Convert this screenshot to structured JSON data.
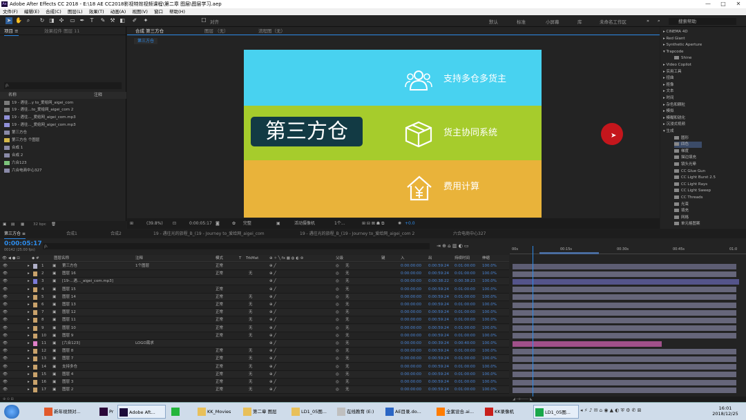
{
  "window": {
    "title": "Adobe After Effects CC 2018 - E:\\18 AE CC2018影视特效视频课程\\第二章 图层\\图层学习.aep",
    "controls": [
      "—",
      "□",
      "✕"
    ]
  },
  "menu": [
    "文件(F)",
    "编辑(E)",
    "合成(C)",
    "图层(L)",
    "效果(T)",
    "动画(A)",
    "视图(V)",
    "窗口",
    "帮助(H)"
  ],
  "toolbar": {
    "snap": "对齐",
    "workspaces": [
      "默认",
      "标准",
      "小屏幕",
      "库",
      "未命名工作区"
    ],
    "search_placeholder": "搜索帮助"
  },
  "project": {
    "tabs": [
      "项目 ≡",
      "效果控件 图层 11"
    ],
    "search_placeholder": "ρ.",
    "columns": {
      "name": "名称",
      "comment": "注释"
    },
    "items": [
      "19 - 遇往...y to_爱给网_aigei_com",
      "19 - 遇往...to_爱给网_aigei_com 2",
      "19 - 遇往..._爱给网_aigei_com.mp3",
      "19 - 遇往..._爱给网_aigei_com.mp3",
      "第三方仓",
      "第三方仓 个图层",
      "合成 1",
      "合成 2",
      "六合123",
      "六合电商中心327"
    ],
    "bpc": "32 bpc"
  },
  "viewer": {
    "tabs": [
      "合成 第三方仓",
      "图层 （无）",
      "流程图（无）"
    ],
    "comp_tab": "第三方仓",
    "canvas": {
      "title": "第三方仓",
      "rows": [
        "支持多仓多货主",
        "货主协同系统",
        "费用计算"
      ],
      "colors": {
        "cyan": "#48d2f0",
        "green": "#a6cc2c",
        "orange": "#e9b33a",
        "title_bg": "#123a44"
      }
    },
    "bottom": {
      "zoom": "(39.8%)",
      "time": "0:00:05:17",
      "quality": "完整",
      "camera": "活动摄像机",
      "views": "1个...",
      "exposure": "+0.0"
    }
  },
  "effects": {
    "items": [
      "▸ CINEMA 4D",
      "▸ Red Giant",
      "▸ Synthetic Aperture",
      "▾ Trapcode",
      "Shine",
      "▸ Video Copilot",
      "▸ 实用工具",
      "▸ 扭曲",
      "▸ 抠像",
      "▸ 文本",
      "▸ 时间",
      "▸ 杂色和颗粒",
      "▸ 模拟",
      "▸ 模糊和锐化",
      "▸ 沉浸式视频",
      "▾ 生成",
      "圆形",
      "四色",
      "梯度",
      "描边填充",
      "镜头光晕",
      "CC Glue Gun",
      "CC Light Burst 2.5",
      "CC Light Rays",
      "CC Light Sweep",
      "CC Threads",
      "光束",
      "填充",
      "网格",
      "单元格图案"
    ]
  },
  "timeline": {
    "tabs": [
      "第三方仓 ≡",
      "合成1",
      "合成2",
      "19 - 遇往光的旅程_B_(19 - Journey to_爱给网_aigei_com",
      "19 - 遇往光的旅程_B_(19 - Journey to_爱给网_aigei_com 2",
      "六合电商中心327"
    ],
    "time": "0:00:05:17",
    "frames": "00142 (25.00 fps)",
    "headers": {
      "name": "图层名称",
      "comment": "注释",
      "mode": "模式",
      "t": "T",
      "trkmat": "TrkMat",
      "parent": "父级",
      "key": "键",
      "in": "入",
      "out": "出",
      "duration": "持续时间",
      "stretch": "伸缩"
    },
    "ruler": [
      "00s",
      "00:15s",
      "00:30s",
      "00:45s",
      "01:0"
    ],
    "layers": [
      {
        "n": "1",
        "name": "第三方仓",
        "comment": "1个图层",
        "mode": "正常",
        "trk": "",
        "parent": "无",
        "in": "0:00:00:00",
        "out": "0:00:59:24",
        "dur": "0:01:00:00",
        "st": "100.0%",
        "color": "#b0b0c8",
        "bar": "#5d5d73"
      },
      {
        "n": "2",
        "name": "图层 16",
        "comment": "",
        "mode": "正常",
        "trk": "无",
        "parent": "无",
        "in": "0:00:00:00",
        "out": "0:00:59:24",
        "dur": "0:01:00:00",
        "st": "100.0%",
        "color": "#c9a26b",
        "bar": "#66667a"
      },
      {
        "n": "3",
        "name": "[19-...遇..._aigei_com.mp3]",
        "comment": "",
        "mode": "",
        "trk": "",
        "parent": "无",
        "in": "0:00:00:00",
        "out": "0:00:38:22",
        "dur": "0:00:38:23",
        "st": "100.0%",
        "color": "#7b7bd8",
        "bar": "#54548a"
      },
      {
        "n": "4",
        "name": "图层 15",
        "comment": "",
        "mode": "正常",
        "trk": "",
        "parent": "无",
        "in": "0:00:00:00",
        "out": "0:00:59:24",
        "dur": "0:01:00:00",
        "st": "100.0%",
        "color": "#c9a26b",
        "bar": "#66667a"
      },
      {
        "n": "5",
        "name": "图层 14",
        "comment": "",
        "mode": "正常",
        "trk": "无",
        "parent": "无",
        "in": "0:00:00:00",
        "out": "0:00:59:24",
        "dur": "0:01:00:00",
        "st": "100.0%",
        "color": "#c9a26b",
        "bar": "#66667a"
      },
      {
        "n": "6",
        "name": "图层 13",
        "comment": "",
        "mode": "正常",
        "trk": "无",
        "parent": "无",
        "in": "0:00:00:00",
        "out": "0:00:59:24",
        "dur": "0:01:00:00",
        "st": "100.0%",
        "color": "#c9a26b",
        "bar": "#66667a"
      },
      {
        "n": "7",
        "name": "图层 12",
        "comment": "",
        "mode": "正常",
        "trk": "无",
        "parent": "无",
        "in": "0:00:00:00",
        "out": "0:00:59:24",
        "dur": "0:01:00:00",
        "st": "100.0%",
        "color": "#c9a26b",
        "bar": "#66667a"
      },
      {
        "n": "8",
        "name": "图层 11",
        "comment": "",
        "mode": "正常",
        "trk": "无",
        "parent": "无",
        "in": "0:00:00:00",
        "out": "0:00:59:24",
        "dur": "0:01:00:00",
        "st": "100.0%",
        "color": "#c9a26b",
        "bar": "#66667a"
      },
      {
        "n": "9",
        "name": "图层 10",
        "comment": "",
        "mode": "正常",
        "trk": "无",
        "parent": "无",
        "in": "0:00:00:00",
        "out": "0:00:59:24",
        "dur": "0:01:00:00",
        "st": "100.0%",
        "color": "#c9a26b",
        "bar": "#66667a"
      },
      {
        "n": "10",
        "name": "图层 9",
        "comment": "",
        "mode": "正常",
        "trk": "无",
        "parent": "无",
        "in": "0:00:00:00",
        "out": "0:00:59:24",
        "dur": "0:01:00:00",
        "st": "100.0%",
        "color": "#c9a26b",
        "bar": "#66667a"
      },
      {
        "n": "11",
        "name": "[六合123]",
        "comment": "LOGO需求",
        "mode": "",
        "trk": "",
        "parent": "无",
        "in": "0:00:00:00",
        "out": "0:00:39:24",
        "dur": "0:00:40:00",
        "st": "100.0%",
        "color": "#e080c8",
        "bar": "#a0508a"
      },
      {
        "n": "12",
        "name": "图层 8",
        "comment": "",
        "mode": "正常",
        "trk": "无",
        "parent": "无",
        "in": "0:00:00:00",
        "out": "0:00:59:24",
        "dur": "0:01:00:00",
        "st": "100.0%",
        "color": "#c9a26b",
        "bar": "#66667a"
      },
      {
        "n": "13",
        "name": "图层 7",
        "comment": "",
        "mode": "正常",
        "trk": "无",
        "parent": "无",
        "in": "0:00:00:00",
        "out": "0:00:59:24",
        "dur": "0:01:00:00",
        "st": "100.0%",
        "color": "#c9a26b",
        "bar": "#66667a"
      },
      {
        "n": "14",
        "name": "支持多仓",
        "comment": "",
        "mode": "正常",
        "trk": "无",
        "parent": "无",
        "in": "0:00:00:00",
        "out": "0:00:59:24",
        "dur": "0:01:00:00",
        "st": "100.0%",
        "color": "#c9a26b",
        "bar": "#66667a"
      },
      {
        "n": "15",
        "name": "图层 4",
        "comment": "",
        "mode": "正常",
        "trk": "无",
        "parent": "无",
        "in": "0:00:00:00",
        "out": "0:00:59:24",
        "dur": "0:01:00:00",
        "st": "100.0%",
        "color": "#c9a26b",
        "bar": "#66667a"
      },
      {
        "n": "16",
        "name": "图层 3",
        "comment": "",
        "mode": "正常",
        "trk": "无",
        "parent": "无",
        "in": "0:00:00:00",
        "out": "0:00:59:24",
        "dur": "0:01:00:00",
        "st": "100.0%",
        "color": "#c9a26b",
        "bar": "#66667a"
      },
      {
        "n": "17",
        "name": "图层 2",
        "comment": "",
        "mode": "正常",
        "trk": "无",
        "parent": "无",
        "in": "0:00:00:00",
        "out": "0:00:59:24",
        "dur": "0:01:00:00",
        "st": "100.0%",
        "color": "#c9a26b",
        "bar": "#66667a"
      }
    ],
    "playhead_fraction": 0.097
  },
  "taskbar": {
    "items": [
      "新年视频对...",
      "Pr",
      "Adobe Aft...",
      "",
      "KK_Movies",
      "第二章 图层",
      "LD1_05图...",
      "在线教育 (E:)",
      "AE目录.do...",
      "全案设合.ai...",
      "KK录像机",
      "LD1_05图..."
    ],
    "clock": "16:01",
    "date": "2018/12/25"
  }
}
